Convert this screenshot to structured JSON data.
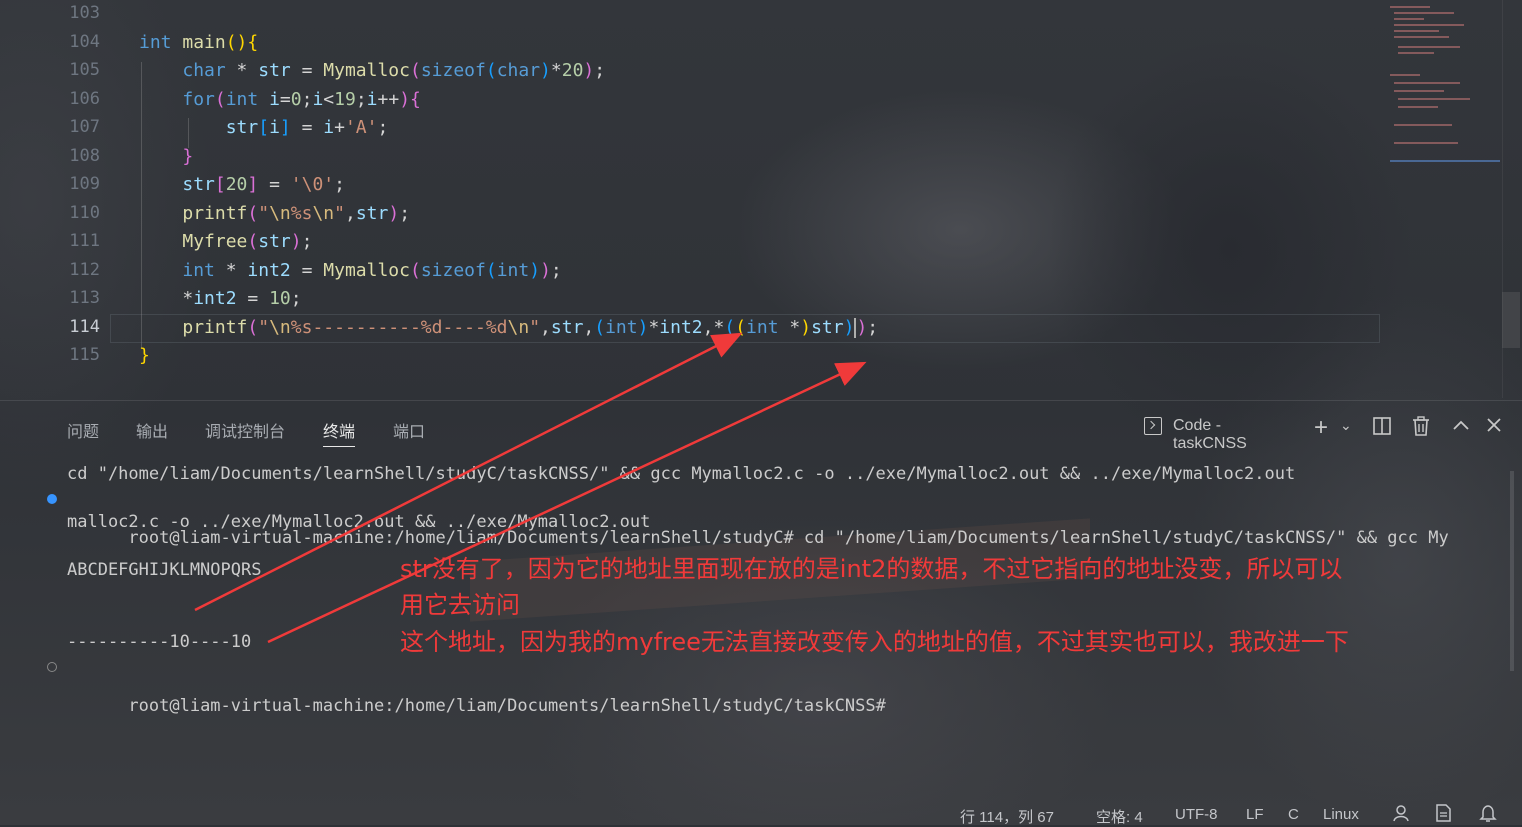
{
  "editor": {
    "lines": [
      {
        "n": "103",
        "tokens": []
      },
      {
        "n": "104",
        "tokens": [
          [
            "kw",
            "int "
          ],
          [
            "fn",
            "main"
          ],
          [
            "br1",
            "()"
          ],
          [
            "br1",
            "{"
          ]
        ]
      },
      {
        "n": "105",
        "tokens": [
          [
            "pn",
            "    "
          ],
          [
            "kw",
            "char "
          ],
          [
            "pn",
            "* "
          ],
          [
            "var",
            "str"
          ],
          [
            "pn",
            " = "
          ],
          [
            "fn",
            "Mymalloc"
          ],
          [
            "br2",
            "("
          ],
          [
            "kw",
            "sizeof"
          ],
          [
            "br3",
            "("
          ],
          [
            "kw",
            "char"
          ],
          [
            "br3",
            ")"
          ],
          [
            "pn",
            "*"
          ],
          [
            "num",
            "20"
          ],
          [
            "br2",
            ")"
          ],
          [
            "pn",
            ";"
          ]
        ]
      },
      {
        "n": "106",
        "tokens": [
          [
            "pn",
            "    "
          ],
          [
            "kw",
            "for"
          ],
          [
            "br2",
            "("
          ],
          [
            "kw",
            "int "
          ],
          [
            "var",
            "i"
          ],
          [
            "pn",
            "="
          ],
          [
            "num",
            "0"
          ],
          [
            "pn",
            ";"
          ],
          [
            "var",
            "i"
          ],
          [
            "pn",
            "<"
          ],
          [
            "num",
            "19"
          ],
          [
            "pn",
            ";"
          ],
          [
            "var",
            "i"
          ],
          [
            "pn",
            "++"
          ],
          [
            "br2",
            ")"
          ],
          [
            "br2",
            "{"
          ]
        ]
      },
      {
        "n": "107",
        "tokens": [
          [
            "pn",
            "        "
          ],
          [
            "var",
            "str"
          ],
          [
            "br3",
            "["
          ],
          [
            "var",
            "i"
          ],
          [
            "br3",
            "]"
          ],
          [
            "pn",
            " = "
          ],
          [
            "var",
            "i"
          ],
          [
            "pn",
            "+"
          ],
          [
            "str",
            "'A'"
          ],
          [
            "pn",
            ";"
          ]
        ]
      },
      {
        "n": "108",
        "tokens": [
          [
            "pn",
            "    "
          ],
          [
            "br2",
            "}"
          ]
        ]
      },
      {
        "n": "109",
        "tokens": [
          [
            "pn",
            "    "
          ],
          [
            "var",
            "str"
          ],
          [
            "br2",
            "["
          ],
          [
            "num",
            "20"
          ],
          [
            "br2",
            "]"
          ],
          [
            "pn",
            " = "
          ],
          [
            "str",
            "'\\0'"
          ],
          [
            "pn",
            ";"
          ]
        ]
      },
      {
        "n": "110",
        "tokens": [
          [
            "pn",
            "    "
          ],
          [
            "fn",
            "printf"
          ],
          [
            "br2",
            "("
          ],
          [
            "str",
            "\""
          ],
          [
            "esc",
            "\\n"
          ],
          [
            "str",
            "%s"
          ],
          [
            "esc",
            "\\n"
          ],
          [
            "str",
            "\""
          ],
          [
            "pn",
            ","
          ],
          [
            "var",
            "str"
          ],
          [
            "br2",
            ")"
          ],
          [
            "pn",
            ";"
          ]
        ]
      },
      {
        "n": "111",
        "tokens": [
          [
            "pn",
            "    "
          ],
          [
            "fn",
            "Myfree"
          ],
          [
            "br2",
            "("
          ],
          [
            "var",
            "str"
          ],
          [
            "br2",
            ")"
          ],
          [
            "pn",
            ";"
          ]
        ]
      },
      {
        "n": "112",
        "tokens": [
          [
            "pn",
            "    "
          ],
          [
            "kw",
            "int "
          ],
          [
            "pn",
            "* "
          ],
          [
            "var",
            "int2"
          ],
          [
            "pn",
            " = "
          ],
          [
            "fn",
            "Mymalloc"
          ],
          [
            "br2",
            "("
          ],
          [
            "kw",
            "sizeof"
          ],
          [
            "br3",
            "("
          ],
          [
            "kw",
            "int"
          ],
          [
            "br3",
            ")"
          ],
          [
            "br2",
            ")"
          ],
          [
            "pn",
            ";"
          ]
        ]
      },
      {
        "n": "113",
        "tokens": [
          [
            "pn",
            "    "
          ],
          [
            "pn",
            "*"
          ],
          [
            "var",
            "int2"
          ],
          [
            "pn",
            " = "
          ],
          [
            "num",
            "10"
          ],
          [
            "pn",
            ";"
          ]
        ]
      },
      {
        "n": "114",
        "tokens": [
          [
            "pn",
            "    "
          ],
          [
            "fn",
            "printf"
          ],
          [
            "br2",
            "("
          ],
          [
            "str",
            "\""
          ],
          [
            "esc",
            "\\n"
          ],
          [
            "str",
            "%s----------%d----%d"
          ],
          [
            "esc",
            "\\n"
          ],
          [
            "str",
            "\""
          ],
          [
            "pn",
            ","
          ],
          [
            "var",
            "str"
          ],
          [
            "pn",
            ","
          ],
          [
            "br3",
            "("
          ],
          [
            "kw",
            "int"
          ],
          [
            "br3",
            ")"
          ],
          [
            "pn",
            "*"
          ],
          [
            "var",
            "int2"
          ],
          [
            "pn",
            ",*"
          ],
          [
            "br3",
            "("
          ],
          [
            "br1",
            "("
          ],
          [
            "kw",
            "int "
          ],
          [
            "pn",
            "*"
          ],
          [
            "br1",
            ")"
          ],
          [
            "var",
            "str"
          ],
          [
            "br3",
            ")"
          ],
          [
            "br2",
            ")"
          ],
          [
            "pn",
            ";"
          ]
        ]
      },
      {
        "n": "115",
        "tokens": [
          [
            "br1",
            "}"
          ]
        ]
      }
    ]
  },
  "panel": {
    "tabs": [
      "问题",
      "输出",
      "调试控制台",
      "终端",
      "端口"
    ],
    "terminal_name": "Code - taskCNSS"
  },
  "terminal": {
    "lines": [
      "cd \"/home/liam/Documents/learnShell/studyC/taskCNSS/\" && gcc Mymalloc2.c -o ../exe/Mymalloc2.out && ../exe/Mymalloc2.out",
      "root@liam-virtual-machine:/home/liam/Documents/learnShell/studyC# cd \"/home/liam/Documents/learnShell/studyC/taskCNSS/\" && gcc My",
      "malloc2.c -o ../exe/Mymalloc2.out && ../exe/Mymalloc2.out",
      "",
      "ABCDEFGHIJKLMNOPQRS",
      "",
      "",
      "----------10----10",
      "root@liam-virtual-machine:/home/liam/Documents/learnShell/studyC/taskCNSS#"
    ]
  },
  "annotation": {
    "line1": "str没有了，因为它的地址里面现在放的是int2的数据，不过它指向的地址没变，所以可以",
    "line2": "用它去访问",
    "line3": "这个地址，因为我的myfree无法直接改变传入的地址的值，不过其实也可以，我改进一下",
    "color": "#f03a3a"
  },
  "statusbar": {
    "position": "行 114，列 67",
    "spaces": "空格: 4",
    "encoding": "UTF-8",
    "eol": "LF",
    "language": "C",
    "platform": "Linux"
  },
  "colors": {
    "keyword": "#569cd6",
    "function": "#dcdcaa",
    "string": "#ce9178",
    "number": "#b5cea8",
    "variable": "#9cdcfe",
    "annotation": "#f03a3a"
  },
  "icons": [
    "terminal-icon",
    "add-icon",
    "chevron-down-icon",
    "split-icon",
    "trash-icon",
    "maximize-icon",
    "close-icon",
    "account-icon",
    "feedback-icon",
    "bell-icon"
  ]
}
